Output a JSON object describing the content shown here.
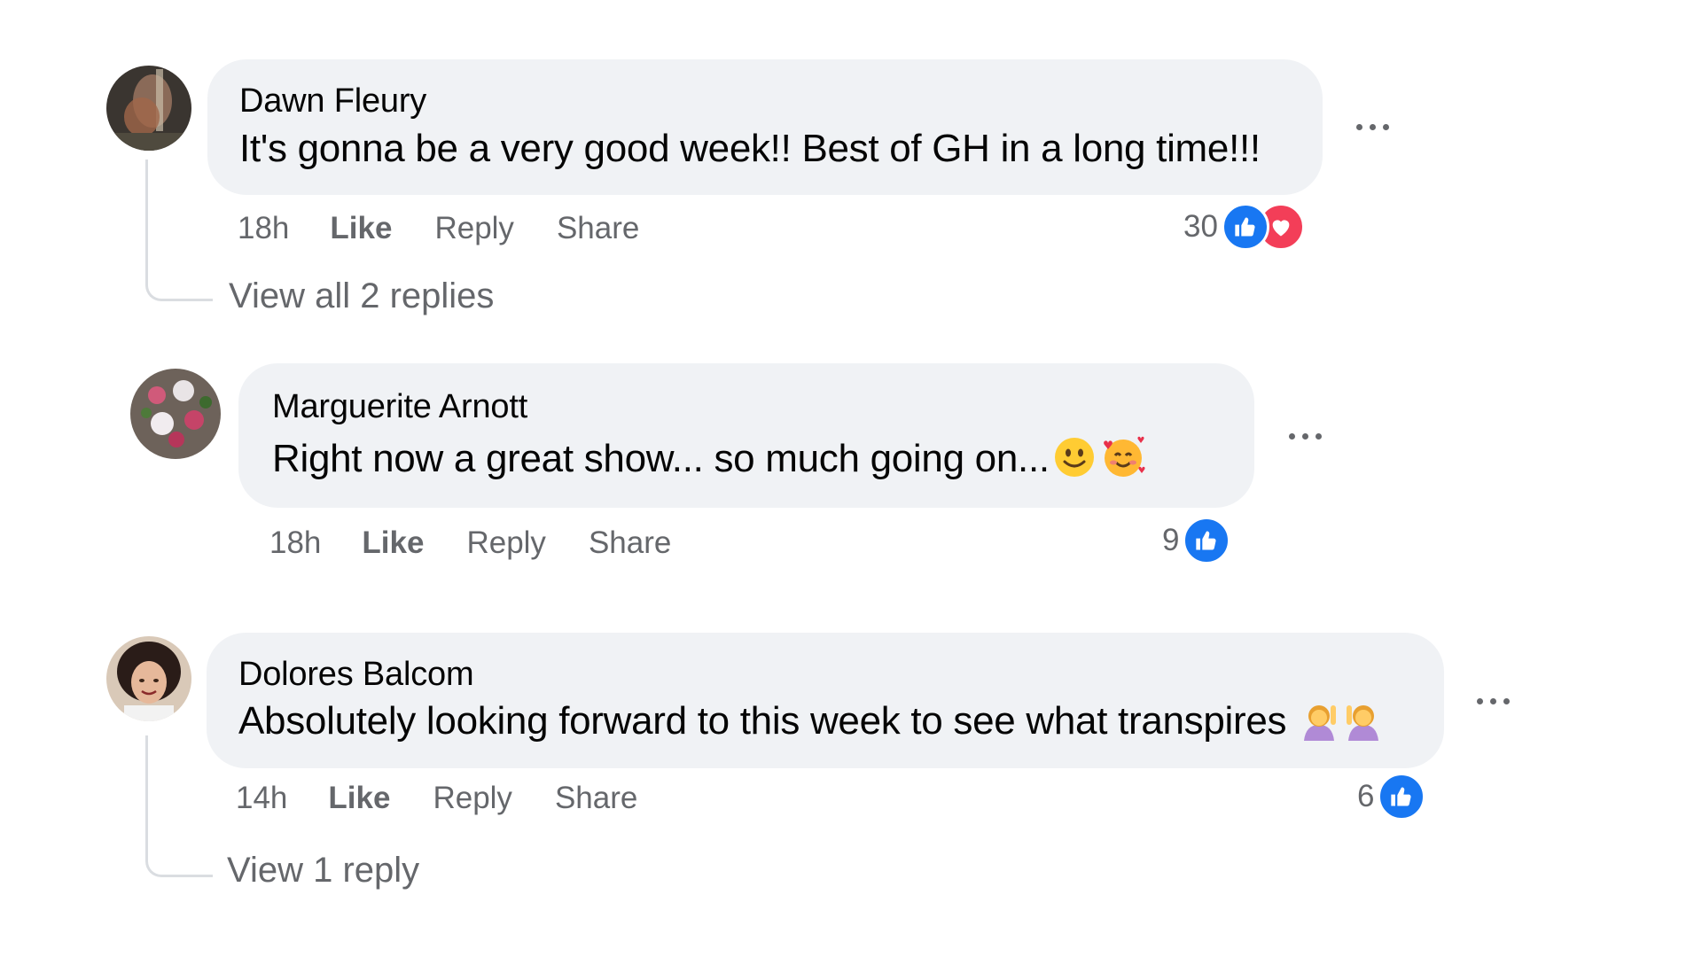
{
  "comments": [
    {
      "author": "Dawn Fleury",
      "text": "It's gonna be a very good week!! Best of GH in a long time!!!",
      "time": "18h",
      "like": "Like",
      "reply": "Reply",
      "share": "Share",
      "reaction_count": "30",
      "reactions": [
        "like-icon",
        "love-icon"
      ],
      "view_replies": "View all 2 replies"
    },
    {
      "author": "Marguerite Arnott",
      "text": "Right now a great show... so much going on...",
      "emojis": [
        "slightly-smiling-face",
        "smiling-face-with-hearts"
      ],
      "time": "18h",
      "like": "Like",
      "reply": "Reply",
      "share": "Share",
      "reaction_count": "9",
      "reactions": [
        "like-icon"
      ]
    },
    {
      "author": "Dolores Balcom",
      "text": "Absolutely looking forward to this week to see what transpires",
      "emojis": [
        "woman-raising-hand",
        "woman-raising-hand"
      ],
      "time": "14h",
      "like": "Like",
      "reply": "Reply",
      "share": "Share",
      "reaction_count": "6",
      "reactions": [
        "like-icon"
      ],
      "view_replies": "View 1 reply"
    }
  ],
  "colors": {
    "bubble": "#f0f2f5",
    "secondary_text": "#65676b",
    "like_blue": "#1877f2",
    "love_red": "#f33e58"
  }
}
